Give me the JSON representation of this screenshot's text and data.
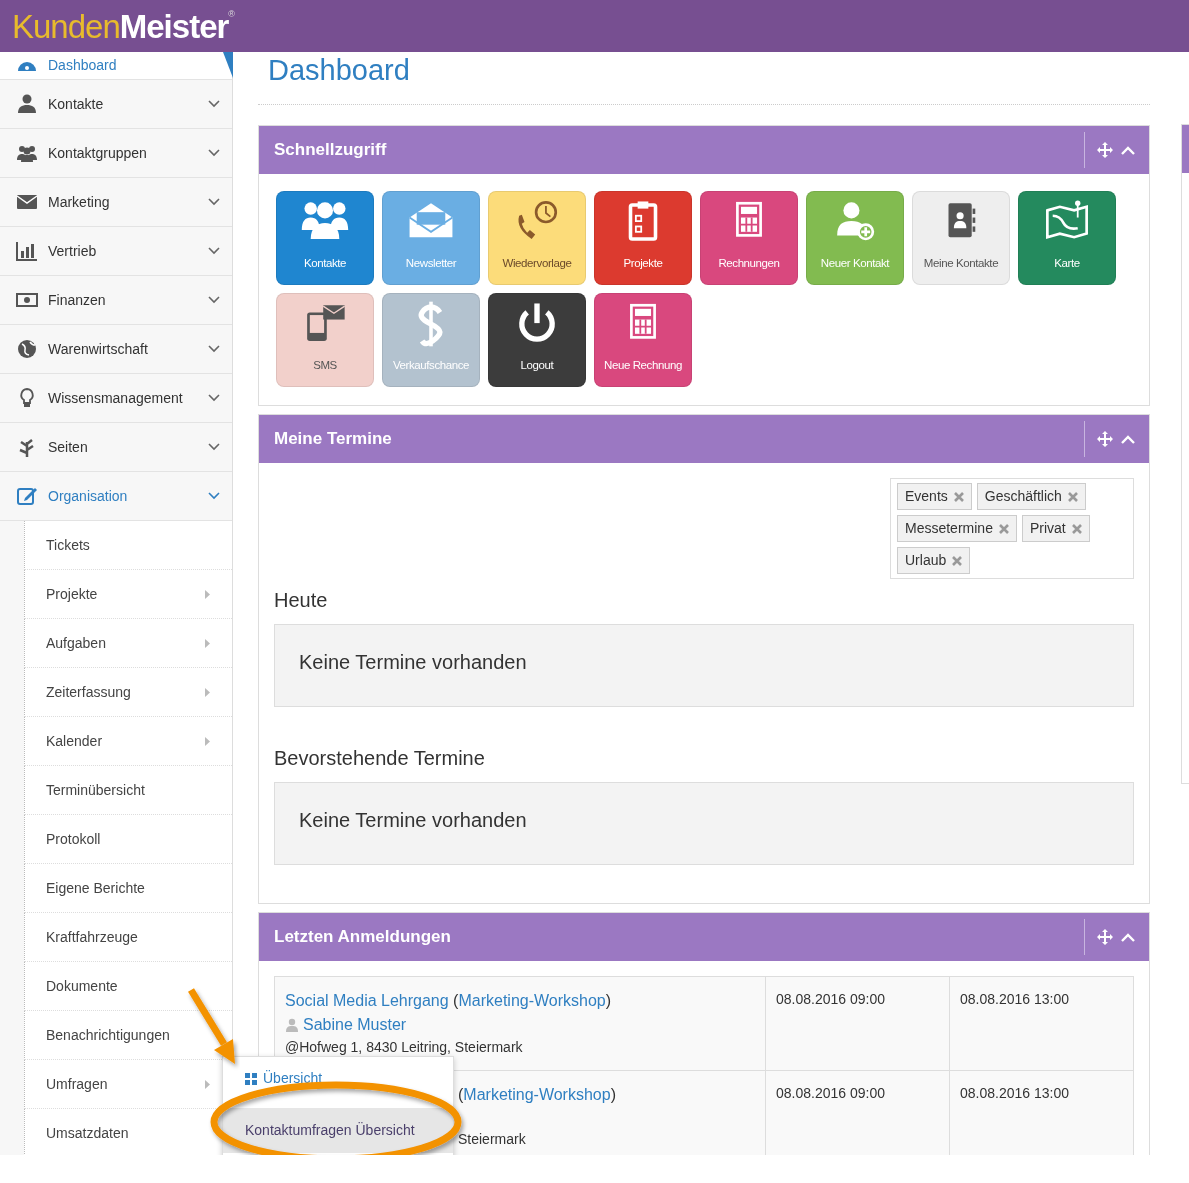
{
  "header": {
    "logo": {
      "first": "Kunden",
      "second": "Meister",
      "mark": "®"
    }
  },
  "sidebar": {
    "items": [
      {
        "label": "Dashboard",
        "kind": "dashboard",
        "selected": true,
        "expanded": false
      },
      {
        "label": "Kontakte",
        "kind": "user",
        "selected": false,
        "expanded": false
      },
      {
        "label": "Kontaktgruppen",
        "kind": "users",
        "selected": false,
        "expanded": false
      },
      {
        "label": "Marketing",
        "kind": "envelope",
        "selected": false,
        "expanded": false
      },
      {
        "label": "Vertrieb",
        "kind": "chart",
        "selected": false,
        "expanded": false
      },
      {
        "label": "Finanzen",
        "kind": "money",
        "selected": false,
        "expanded": false
      },
      {
        "label": "Warenwirtschaft",
        "kind": "globe",
        "selected": false,
        "expanded": false
      },
      {
        "label": "Wissensmanagement",
        "kind": "bulb",
        "selected": false,
        "expanded": false
      },
      {
        "label": "Seiten",
        "kind": "leaf",
        "selected": false,
        "expanded": false
      },
      {
        "label": "Organisation",
        "kind": "edit",
        "selected": false,
        "expanded": true,
        "children": [
          {
            "label": "Tickets",
            "submenu": false
          },
          {
            "label": "Projekte",
            "submenu": true
          },
          {
            "label": "Aufgaben",
            "submenu": true
          },
          {
            "label": "Zeiterfassung",
            "submenu": true
          },
          {
            "label": "Kalender",
            "submenu": true
          },
          {
            "label": "Terminübersicht",
            "submenu": false
          },
          {
            "label": "Protokoll",
            "submenu": false
          },
          {
            "label": "Eigene Berichte",
            "submenu": false
          },
          {
            "label": "Kraftfahrzeuge",
            "submenu": false
          },
          {
            "label": "Dokumente",
            "submenu": false
          },
          {
            "label": "Benachrichtigungen",
            "submenu": false
          },
          {
            "label": "Umfragen",
            "submenu": true
          },
          {
            "label": "Umsatzdaten",
            "submenu": false
          }
        ]
      }
    ]
  },
  "page_title": "Dashboard",
  "quick_access": {
    "title": "Schnellzugriff",
    "tiles": [
      {
        "label": "Kontakte",
        "kind": "people",
        "color": "#1f86d0"
      },
      {
        "label": "Newsletter",
        "kind": "newsletter",
        "color": "#6aaee3"
      },
      {
        "label": "Wiedervorlage",
        "kind": "phone",
        "color": "#fcdc7a"
      },
      {
        "label": "Projekte",
        "kind": "clipboard",
        "color": "#dc3a2f"
      },
      {
        "label": "Rechnungen",
        "kind": "calculator",
        "color": "#d9487e"
      },
      {
        "label": "Neuer Kontakt",
        "kind": "useradd",
        "color": "#82bb50"
      },
      {
        "label": "Meine Kontakte",
        "kind": "addressbook",
        "color": "#eeeeee"
      },
      {
        "label": "Karte",
        "kind": "map",
        "color": "#248a5e"
      },
      {
        "label": "SMS",
        "kind": "sms",
        "color": "#f2d0cb"
      },
      {
        "label": "Verkaufschance",
        "kind": "dollar",
        "color": "#b3c2cf"
      },
      {
        "label": "Logout",
        "kind": "power",
        "color": "#3c3c3c"
      },
      {
        "label": "Neue Rechnung",
        "kind": "calculator",
        "color": "#d9487e"
      }
    ]
  },
  "appointments": {
    "title": "Meine Termine",
    "tags": [
      "Events",
      "Geschäftlich",
      "Messetermine",
      "Privat",
      "Urlaub"
    ],
    "sections": [
      {
        "heading": "Heute",
        "message": "Keine Termine vorhanden"
      },
      {
        "heading": "Bevorstehende Termine",
        "message": "Keine Termine vorhanden"
      }
    ]
  },
  "logins": {
    "title": "Letzten Anmeldungen",
    "rows": [
      {
        "title": [
          {
            "kind": "link",
            "text": "Social Media Lehrgang"
          },
          {
            "kind": "text",
            "text": " ("
          },
          {
            "kind": "link",
            "text": "Marketing-Workshop"
          },
          {
            "kind": "text",
            "text": ")"
          }
        ],
        "contact": "Sabine Muster",
        "address": "@Hofweg 1, 8430 Leitring, Steiermark",
        "start": "08.08.2016 09:00",
        "end": "08.08.2016 13:00",
        "partly_covered": false
      },
      {
        "title": [
          {
            "kind": "text",
            "text": "("
          },
          {
            "kind": "link",
            "text": "Marketing-Workshop"
          },
          {
            "kind": "text",
            "text": ")"
          }
        ],
        "address": "Steiermark",
        "start": "08.08.2016 09:00",
        "end": "08.08.2016 13:00",
        "partly_covered": true
      }
    ]
  },
  "flyout_menu": {
    "items": [
      {
        "label": "Übersicht",
        "kind": "grid",
        "selected": false
      },
      {
        "label": "Kontaktumfragen Übersicht",
        "kind": "plain",
        "selected": true
      }
    ]
  }
}
